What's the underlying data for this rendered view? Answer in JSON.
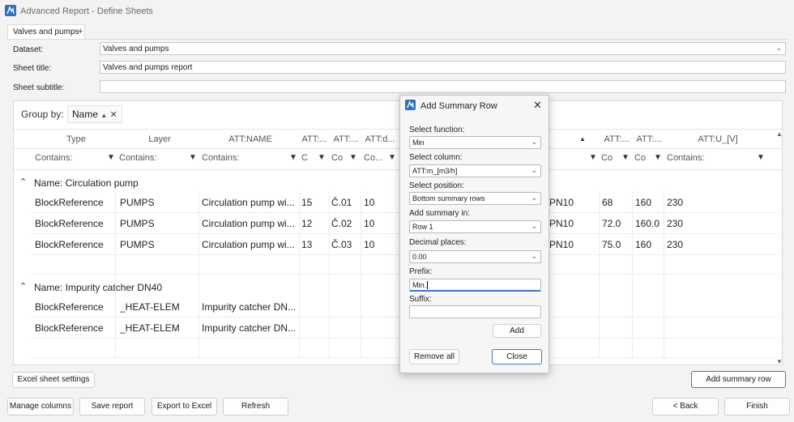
{
  "window": {
    "title": "Advanced Report - Define Sheets"
  },
  "tabs": [
    {
      "label": "Valves and pumps"
    }
  ],
  "tab_add": "+",
  "form": {
    "dataset_label": "Dataset:",
    "dataset_value": "Valves and pumps",
    "sheet_title_label": "Sheet title:",
    "sheet_title_value": "Valves and pumps report",
    "sheet_subtitle_label": "Sheet subtitle:",
    "sheet_subtitle_value": ""
  },
  "grid": {
    "group_by_label": "Group by:",
    "group_chip": "Name",
    "group_chip_sort": "▲",
    "group_chip_close": "✕",
    "headers": [
      "Type",
      "Layer",
      "ATT:NAME",
      "ATT:...",
      "ATT:...",
      "ATT:d...",
      "ATT:...",
      "ATT:...",
      "ATT:U_[V]"
    ],
    "sort_indicator": "▲",
    "filters": [
      "Contains:",
      "Contains:",
      "Contains:",
      "C",
      "Co",
      "Co...",
      "Co",
      "Co",
      "Contains:"
    ],
    "groups": [
      {
        "title": "Name: Circulation pump",
        "rows": [
          {
            "type": "BlockReference",
            "layer": "PUMPS",
            "name": "Circulation pump wi...",
            "c1": "15",
            "c2": "Č.01",
            "c3": "10",
            "dn": "PN10",
            "c7": "68",
            "c8": "160",
            "u": "230"
          },
          {
            "type": "BlockReference",
            "layer": "PUMPS",
            "name": "Circulation pump wi...",
            "c1": "12",
            "c2": "Č.02",
            "c3": "10",
            "dn": "PN10",
            "c7": "72.0",
            "c8": "160.0",
            "u": "230"
          },
          {
            "type": "BlockReference",
            "layer": "PUMPS",
            "name": "Circulation pump wi...",
            "c1": "13",
            "c2": "Č.03",
            "c3": "10",
            "dn": "PN10",
            "c7": "75.0",
            "c8": "160",
            "u": "230"
          }
        ]
      },
      {
        "title": "Name: Impurity catcher DN40",
        "rows": [
          {
            "type": "BlockReference",
            "layer": "_HEAT-ELEM",
            "name": "Impurity catcher DN..."
          },
          {
            "type": "BlockReference",
            "layer": "_HEAT-ELEM",
            "name": "Impurity catcher DN..."
          }
        ]
      }
    ]
  },
  "buttons": {
    "excel_sheet_settings": "Excel sheet settings",
    "add_summary_row": "Add summary row",
    "manage_columns": "Manage columns",
    "save_report": "Save report",
    "export_to_excel": "Export to Excel",
    "refresh": "Refresh",
    "back": "< Back",
    "finish": "Finish"
  },
  "dialog": {
    "title": "Add Summary Row",
    "select_function_label": "Select function:",
    "select_function_value": "Min",
    "select_column_label": "Select column:",
    "select_column_value": "ATT:m_[m3/h]",
    "select_position_label": "Select position:",
    "select_position_value": "Bottom summary rows",
    "add_summary_in_label": "Add summary in:",
    "add_summary_in_value": "Row 1",
    "decimal_places_label": "Decimal places:",
    "decimal_places_value": "0.00",
    "prefix_label": "Prefix:",
    "prefix_value": "Min.",
    "suffix_label": "Suffix:",
    "suffix_value": "",
    "add_button": "Add",
    "remove_all_button": "Remove all",
    "close_button": "Close"
  },
  "icons": {
    "app": "app-logo-icon",
    "dropdown": "chevron-down-icon",
    "filter": "funnel-icon",
    "collapse": "chevron-up-icon",
    "close": "close-icon"
  },
  "colors": {
    "accent": "#3c78c8",
    "app_icon": "#2f6fc0"
  }
}
